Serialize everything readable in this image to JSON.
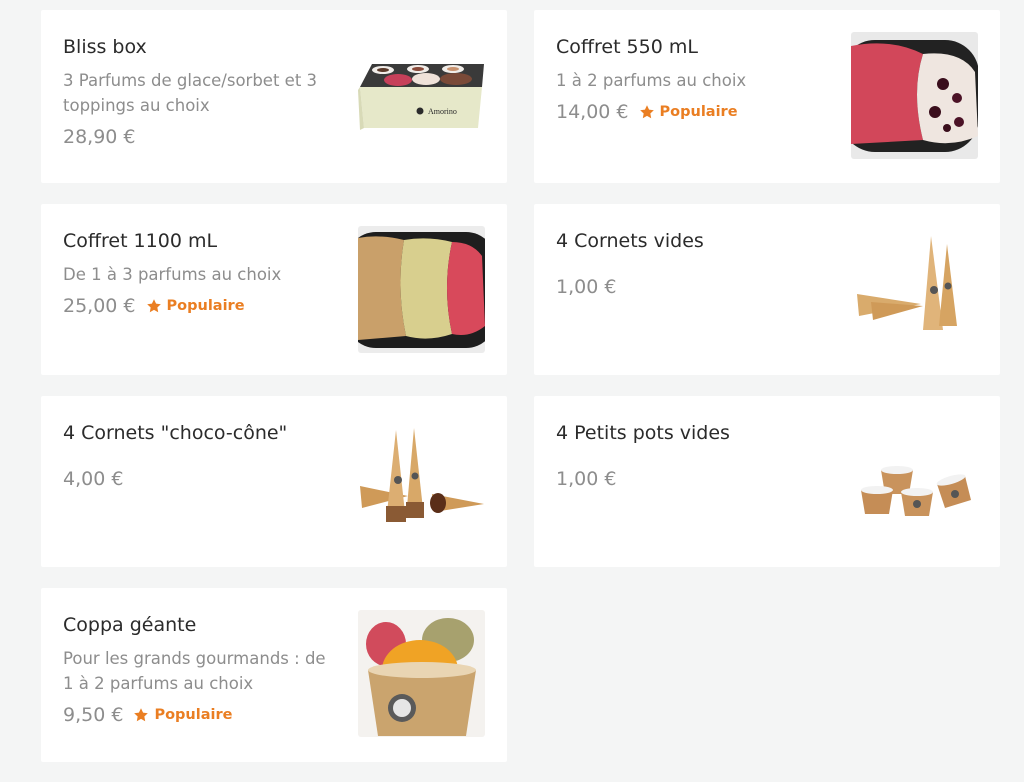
{
  "accent_color": "#ea7e22",
  "products": [
    {
      "name": "Bliss box",
      "description": "3 Parfums de glace/sorbet et 3 toppings au choix",
      "price": "28,90 €",
      "badge": ""
    },
    {
      "name": "Coffret 550 mL",
      "description": "1 à 2 parfums au choix",
      "price": "14,00 €",
      "badge": "Populaire"
    },
    {
      "name": "Coffret 1100 mL",
      "description": "De 1 à 3 parfums au choix",
      "price": "25,00 €",
      "badge": "Populaire"
    },
    {
      "name": "4 Cornets vides",
      "description": "",
      "price": "1,00 €",
      "badge": ""
    },
    {
      "name": "4 Cornets \"choco-cône\"",
      "description": "",
      "price": "4,00 €",
      "badge": ""
    },
    {
      "name": "4 Petits pots vides",
      "description": "",
      "price": "1,00 €",
      "badge": ""
    },
    {
      "name": "Coppa géante",
      "description": "Pour les grands gourmands : de 1 à 2 parfums au choix",
      "price": "9,50 €",
      "badge": "Populaire"
    }
  ],
  "images": {
    "bliss_box": "ice-cream-box-photo",
    "coffret_550": "ice-cream-tub-photo",
    "coffret_1100": "ice-cream-tub-photo",
    "cornets_vides": "waffle-cones-photo",
    "choco_cone": "chocolate-cones-photo",
    "petits_pots": "paper-cups-photo",
    "coppa": "ice-cream-cup-photo"
  }
}
